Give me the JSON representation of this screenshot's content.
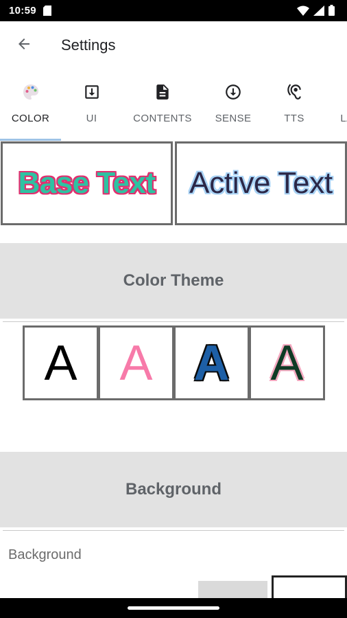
{
  "status_bar": {
    "time": "10:59",
    "icons": [
      "sd-card-icon",
      "wifi-icon",
      "cellular-signal-icon",
      "battery-icon"
    ]
  },
  "app_bar": {
    "back_icon": "arrow-left-icon",
    "title": "Settings"
  },
  "tabs": [
    {
      "label": "COLOR",
      "icon": "palette-icon",
      "active": true
    },
    {
      "label": "UI",
      "icon": "download-box-icon",
      "active": false
    },
    {
      "label": "CONTENTS",
      "icon": "document-icon",
      "active": false
    },
    {
      "label": "SENSE",
      "icon": "arrow-down-circle-icon",
      "active": false
    },
    {
      "label": "TTS",
      "icon": "hearing-icon",
      "active": false
    },
    {
      "label": "LA",
      "icon": "",
      "active": false
    }
  ],
  "preview": {
    "base_text": "Base Text",
    "active_text": "Active Text"
  },
  "sections": {
    "color_theme": "Color Theme",
    "background": "Background"
  },
  "color_themes": [
    {
      "letter": "A",
      "fill": "#000000",
      "outline": "none"
    },
    {
      "letter": "A",
      "fill": "#f77aa9",
      "outline": "none"
    },
    {
      "letter": "A",
      "fill": "#1d5fa6",
      "outline": "#0a0a0a"
    },
    {
      "letter": "A",
      "fill": "#0f3b25",
      "outline": "#f3a8bf"
    }
  ],
  "background": {
    "label": "Background",
    "options": [
      "#dadada",
      "#ffffff"
    ]
  },
  "colors": {
    "tab_indicator": "#9ec3e6",
    "section_header_bg": "#e2e2e2",
    "base_text_fill": "#2ec2a2",
    "base_text_outline": "#e0306f",
    "active_text_fill": "#2b2747",
    "active_text_outline": "#a9d3f5"
  }
}
